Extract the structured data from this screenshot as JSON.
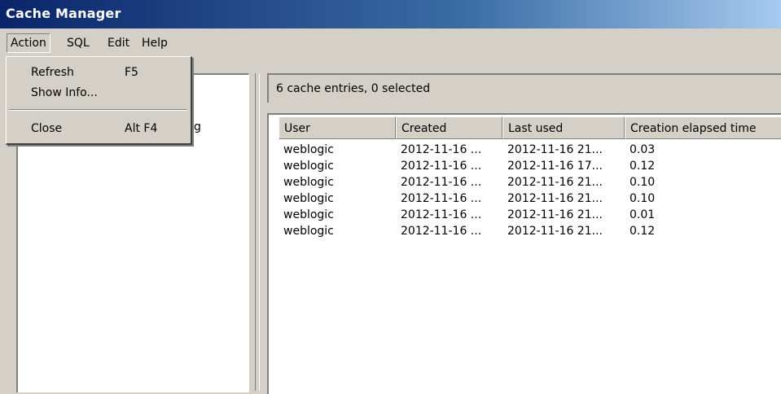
{
  "window": {
    "title": "Cache Manager"
  },
  "menubar": {
    "items": [
      {
        "label": "Action"
      },
      {
        "label": "SQL"
      },
      {
        "label": "Edit"
      },
      {
        "label": "Help"
      }
    ]
  },
  "action_menu": {
    "items": [
      {
        "label": "Refresh",
        "shortcut": "F5"
      },
      {
        "label": "Show Info...",
        "shortcut": ""
      },
      {
        "label": "Close",
        "shortcut": "Alt F4"
      }
    ]
  },
  "left_panel": {
    "partial_text": "g"
  },
  "status": {
    "text": "6 cache entries, 0 selected"
  },
  "table": {
    "columns": [
      "User",
      "Created",
      "Last used",
      "Creation elapsed time"
    ],
    "rows": [
      [
        "weblogic",
        "2012-11-16 ...",
        "2012-11-16 21...",
        "0.03"
      ],
      [
        "weblogic",
        "2012-11-16 ...",
        "2012-11-16 17...",
        "0.12"
      ],
      [
        "weblogic",
        "2012-11-16 ...",
        "2012-11-16 21...",
        "0.10"
      ],
      [
        "weblogic",
        "2012-11-16 ...",
        "2012-11-16 21...",
        "0.10"
      ],
      [
        "weblogic",
        "2012-11-16 ...",
        "2012-11-16 21...",
        "0.01"
      ],
      [
        "weblogic",
        "2012-11-16 ...",
        "2012-11-16 21...",
        "0.12"
      ]
    ]
  }
}
